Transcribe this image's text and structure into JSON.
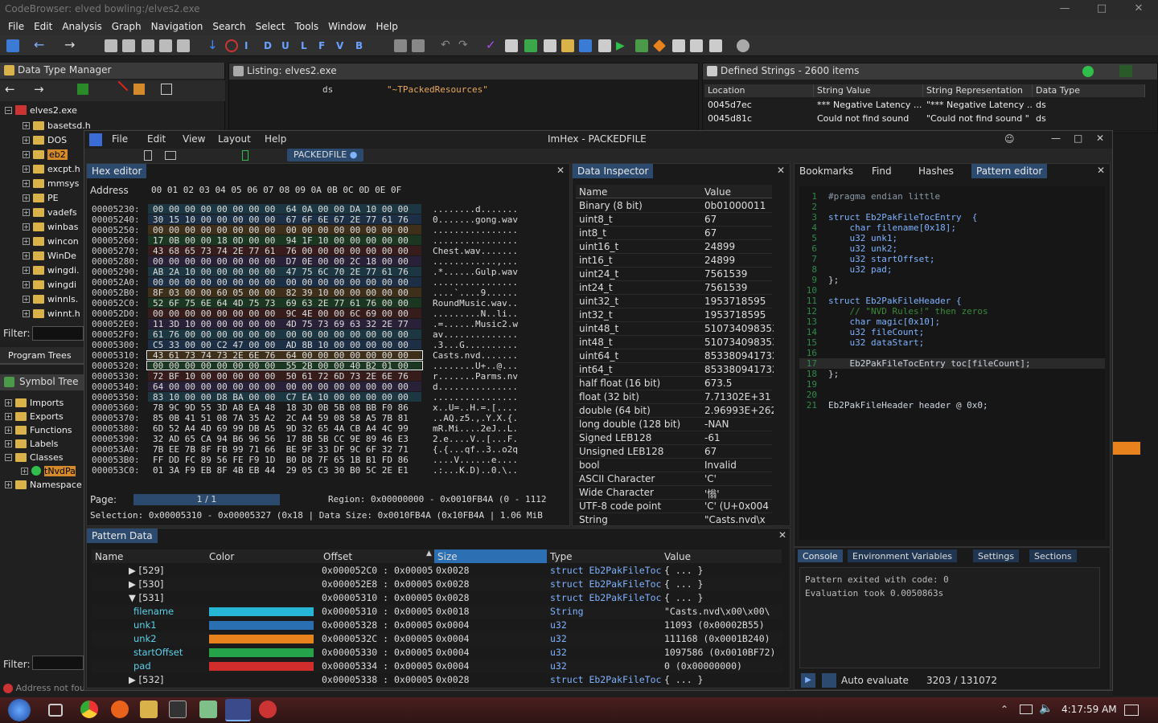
{
  "codebrowser": {
    "title": "CodeBrowser: elved bowling:/elves2.exe",
    "menu": [
      "File",
      "Edit",
      "Analysis",
      "Graph",
      "Navigation",
      "Search",
      "Select",
      "Tools",
      "Window",
      "Help"
    ],
    "toolbar_letters": [
      "I",
      "D",
      "U",
      "L",
      "F",
      "V",
      "B"
    ]
  },
  "dtm": {
    "title": "Data Type Manager",
    "root": "elves2.exe",
    "items": [
      "basetsd.h",
      "DOS",
      "eb2",
      "excpt.h",
      "mmsys",
      "PE",
      "vadefs",
      "winbas",
      "wincon",
      "WinDe",
      "wingdi.",
      "wingdi",
      "winnls.",
      "winnt.h"
    ],
    "filter_label": "Filter:",
    "program_trees": "Program Trees",
    "symbol_tree": "Symbol Tree",
    "symbols": [
      "Imports",
      "Exports",
      "Functions",
      "Labels",
      "Classes",
      "tNvdPa",
      "Namespace"
    ],
    "filter2_label": "Filter:",
    "status": "Address not fou"
  },
  "listing": {
    "title": "Listing:  elves2.exe",
    "line_mnemonic": "ds",
    "line_value": "\"~TPackedResources\""
  },
  "strings": {
    "title": "Defined Strings - 2600 items",
    "columns": [
      "Location",
      "String Value",
      "String Representation",
      "Data Type"
    ],
    "rows": [
      [
        "0045d7ec",
        "*** Negative Latency ...",
        "\"*** Negative Latency ...",
        "ds"
      ],
      [
        "0045d81c",
        "Could not find sound",
        "\"Could not find sound \"",
        "ds"
      ]
    ]
  },
  "imhex": {
    "title": "ImHex - PACKEDFILE",
    "menu": [
      "File",
      "Edit",
      "View",
      "Layout",
      "Help"
    ],
    "file_tab": "PACKEDFILE",
    "hex_editor": {
      "tab": "Hex editor",
      "address_label": "Address",
      "header": "00 01 02 03 04 05 06 07  08 09 0A 0B 0C 0D 0E 0F",
      "rows": [
        [
          "00005230:",
          "00 00 00 00 00 00 00 00  64 0A 00 00 DA 10 00 00",
          "........d......."
        ],
        [
          "00005240:",
          "30 15 10 00 00 00 00 00  67 6F 6E 67 2E 77 61 76",
          "0.......gong.wav"
        ],
        [
          "00005250:",
          "00 00 00 00 00 00 00 00  00 00 00 00 00 00 00 00",
          "................"
        ],
        [
          "00005260:",
          "17 0B 00 00 18 0D 00 00  94 1F 10 00 00 00 00 00",
          "................"
        ],
        [
          "00005270:",
          "43 68 65 73 74 2E 77 61  76 00 00 00 00 00 00 00",
          "Chest.wav......."
        ],
        [
          "00005280:",
          "00 00 00 00 00 00 00 00  D7 0E 00 00 2C 18 00 00",
          "............,..."
        ],
        [
          "00005290:",
          "AB 2A 10 00 00 00 00 00  47 75 6C 70 2E 77 61 76",
          ".*......Gulp.wav"
        ],
        [
          "000052A0:",
          "00 00 00 00 00 00 00 00  00 00 00 00 00 00 00 00",
          "................"
        ],
        [
          "000052B0:",
          "8F 03 00 00 60 05 00 00  82 39 10 00 00 00 00 00",
          "....`....9......"
        ],
        [
          "000052C0:",
          "52 6F 75 6E 64 4D 75 73  69 63 2E 77 61 76 00 00",
          "RoundMusic.wav.."
        ],
        [
          "000052D0:",
          "00 00 00 00 00 00 00 00  9C 4E 00 00 6C 69 00 00",
          ".........N..li.."
        ],
        [
          "000052E0:",
          "11 3D 10 00 00 00 00 00  4D 75 73 69 63 32 2E 77",
          ".=......Music2.w"
        ],
        [
          "000052F0:",
          "61 76 00 00 00 00 00 00  00 00 00 00 00 00 00 00",
          "av.............."
        ],
        [
          "00005300:",
          "C5 33 00 00 C2 47 00 00  AD 8B 10 00 00 00 00 00",
          ".3...G.........."
        ],
        [
          "00005310:",
          "43 61 73 74 73 2E 6E 76  64 00 00 00 00 00 00 00",
          "Casts.nvd......."
        ],
        [
          "00005320:",
          "00 00 00 00 00 00 00 00  55 2B 00 00 40 B2 01 00",
          "........U+..@..."
        ],
        [
          "00005330:",
          "72 BF 10 00 00 00 00 00  50 61 72 6D 73 2E 6E 76",
          "r.......Parms.nv"
        ],
        [
          "00005340:",
          "64 00 00 00 00 00 00 00  00 00 00 00 00 00 00 00",
          "d..............."
        ],
        [
          "00005350:",
          "83 10 00 00 D8 BA 00 00  C7 EA 10 00 00 00 00 00",
          "................"
        ],
        [
          "00005360:",
          "78 9C 9D 55 3D A8 EA 48  18 3D 0B 5B 08 BB F0 86",
          "x..U=..H.=.[...."
        ],
        [
          "00005370:",
          "85 0B 41 51 08 7A 35 A2  2C A4 59 08 58 A5 7B 81",
          "..AQ.z5.,.Y.X.{."
        ],
        [
          "00005380:",
          "6D 52 A4 4D 69 99 DB A5  9D 32 65 4A CB A4 4C 99",
          "mR.Mi....2eJ..L."
        ],
        [
          "00005390:",
          "32 AD 65 CA 94 B6 96 56  17 8B 5B CC 9E 89 46 E3",
          "2.e....V..[...F."
        ],
        [
          "000053A0:",
          "7B EE 7B 8F FB 99 71 66  BE 9F 33 DF 9C 6F 32 71",
          "{.{...qf..3..o2q"
        ],
        [
          "000053B0:",
          "FF DD FC 89 56 FE F9 1D  B0 D8 7F 65 1B B1 FD 86",
          "....V......e...."
        ],
        [
          "000053C0:",
          "01 3A F9 EB 8F 4B EB 44  29 05 C3 30 B0 5C 2E E1",
          ".:...K.D)..0.\\.."
        ]
      ],
      "page_label": "Page:",
      "page_value": "1 / 1",
      "region": "Region: 0x00000000 - 0x0010FB4A (0 - 1112",
      "selection": "Selection: 0x00005310 - 0x00005327 (0x18 | Data Size: 0x0010FB4A (0x10FB4A | 1.06 MiB"
    },
    "inspector": {
      "tab": "Data Inspector",
      "columns": [
        "Name",
        "Value"
      ],
      "rows": [
        [
          "Binary (8 bit)",
          "0b01000011"
        ],
        [
          "uint8_t",
          "67"
        ],
        [
          "int8_t",
          "67"
        ],
        [
          "uint16_t",
          "24899"
        ],
        [
          "int16_t",
          "24899"
        ],
        [
          "uint24_t",
          "7561539"
        ],
        [
          "int24_t",
          "7561539"
        ],
        [
          "uint32_t",
          "1953718595"
        ],
        [
          "int32_t",
          "1953718595"
        ],
        [
          "uint48_t",
          "510734098353"
        ],
        [
          "int48_t",
          "510734098353"
        ],
        [
          "uint64_t",
          "853380941732"
        ],
        [
          "int64_t",
          "853380941732"
        ],
        [
          "half float (16 bit)",
          "673.5"
        ],
        [
          "float (32 bit)",
          "7.71302E+31"
        ],
        [
          "double (64 bit)",
          "2.96993E+262"
        ],
        [
          "long double (128 bit)",
          "-NAN"
        ],
        [
          "Signed LEB128",
          "-61"
        ],
        [
          "Unsigned LEB128",
          "67"
        ],
        [
          "bool",
          "Invalid"
        ],
        [
          "ASCII Character",
          "'C'"
        ],
        [
          "Wide Character",
          "'慃'"
        ],
        [
          "UTF-8 code point",
          "'C' (U+0x004"
        ],
        [
          "String",
          "\"Casts.nvd\\x"
        ]
      ]
    },
    "right_tabs": [
      "Bookmarks",
      "Find",
      "Hashes",
      "Pattern editor"
    ],
    "pattern_code": [
      "#pragma endian little",
      "",
      "struct Eb2PakFileTocEntry  {",
      "    char filename[0x18];",
      "    u32 unk1;",
      "    u32 unk2;",
      "    u32 startOffset;",
      "    u32 pad;",
      "};",
      "",
      "struct Eb2PakFileHeader {",
      "    // \"NVD Rules!\" then zeros",
      "    char magic[0x10];",
      "    u32 fileCount;",
      "    u32 dataStart;",
      "",
      "    Eb2PakFileTocEntry toc[fileCount];",
      "};",
      "",
      "",
      "Eb2PakFileHeader header @ 0x0;"
    ],
    "console_tabs": [
      "Console",
      "Environment Variables",
      "Settings",
      "Sections"
    ],
    "console_lines": [
      "Pattern exited with code: 0",
      "Evaluation took 0.0050863s"
    ],
    "auto_evaluate": "Auto evaluate",
    "eval_count": "3203 / 131072",
    "pattern_data": {
      "tab": "Pattern Data",
      "columns": [
        "Name",
        "Color",
        "Offset",
        "Size",
        "Type",
        "Value"
      ],
      "rows": [
        {
          "name": "▶ [529]",
          "color": "",
          "offset": "0x000052C0 : 0x00005",
          "size": "0x0028",
          "type": "struct Eb2PakFileToc",
          "value": "{ ... }",
          "child": false
        },
        {
          "name": "▶ [530]",
          "color": "",
          "offset": "0x000052E8 : 0x00005",
          "size": "0x0028",
          "type": "struct Eb2PakFileToc",
          "value": "{ ... }",
          "child": false
        },
        {
          "name": "▼ [531]",
          "color": "",
          "offset": "0x00005310 : 0x00005",
          "size": "0x0028",
          "type": "struct Eb2PakFileToc",
          "value": "{ ... }",
          "child": false
        },
        {
          "name": "filename",
          "color": "#27b6d6",
          "offset": "0x00005310 : 0x00005",
          "size": "0x0018",
          "type": "String",
          "value": "\"Casts.nvd\\x00\\x00\\",
          "child": true
        },
        {
          "name": "unk1",
          "color": "#2b6fb3",
          "offset": "0x00005328 : 0x00005",
          "size": "0x0004",
          "type": "u32",
          "value": "11093 (0x00002B55)",
          "child": true
        },
        {
          "name": "unk2",
          "color": "#e8821c",
          "offset": "0x0000532C : 0x00005",
          "size": "0x0004",
          "type": "u32",
          "value": "111168 (0x0001B240)",
          "child": true
        },
        {
          "name": "startOffset",
          "color": "#24a34a",
          "offset": "0x00005330 : 0x00005",
          "size": "0x0004",
          "type": "u32",
          "value": "1097586 (0x0010BF72)",
          "child": true
        },
        {
          "name": "pad",
          "color": "#d12d2d",
          "offset": "0x00005334 : 0x00005",
          "size": "0x0004",
          "type": "u32",
          "value": "0 (0x00000000)",
          "child": true
        },
        {
          "name": "▶ [532]",
          "color": "",
          "offset": "0x00005338 : 0x00005",
          "size": "0x0028",
          "type": "struct Eb2PakFileToc",
          "value": "{ ... }",
          "child": false
        }
      ]
    }
  },
  "taskbar": {
    "clock": "4:17:59 AM"
  }
}
